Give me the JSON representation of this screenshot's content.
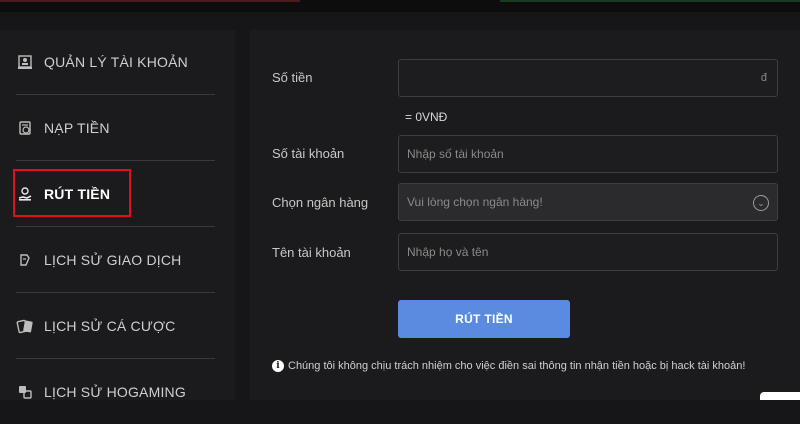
{
  "sidebar": {
    "items": [
      {
        "label": "QUẢN LÝ TÀI KHOẢN",
        "icon": "account-management-icon"
      },
      {
        "label": "NẠP TIỀN",
        "icon": "deposit-icon"
      },
      {
        "label": "RÚT TIỀN",
        "icon": "withdraw-icon",
        "active": true
      },
      {
        "label": "LỊCH SỬ GIAO DỊCH",
        "icon": "transaction-history-icon"
      },
      {
        "label": "LỊCH SỬ CÁ CƯỢC",
        "icon": "betting-history-icon"
      },
      {
        "label": "LỊCH SỬ HOGAMING",
        "icon": "hogaming-history-icon"
      }
    ]
  },
  "form": {
    "amount_label": "Số tiền",
    "amount_value": "",
    "amount_suffix": "đ",
    "converted": "= 0VNĐ",
    "account_number_label": "Số tài khoản",
    "account_number_placeholder": "Nhập số tài khoản",
    "bank_label": "Chọn ngân hàng",
    "bank_selected": "Vui lòng chọn ngân hàng!",
    "account_name_label": "Tên tài khoản",
    "account_name_placeholder": "Nhập họ và tên",
    "submit_label": "RÚT TIỀN",
    "notice": "Chúng tôi không chịu trách nhiệm cho việc điền sai thông tin nhận tiền hoặc bị hack tài khoản!"
  },
  "colors": {
    "background": "#161618",
    "panel": "#1b1b1d",
    "accent_button": "#5b8be0",
    "highlight_border": "#e0111a"
  }
}
